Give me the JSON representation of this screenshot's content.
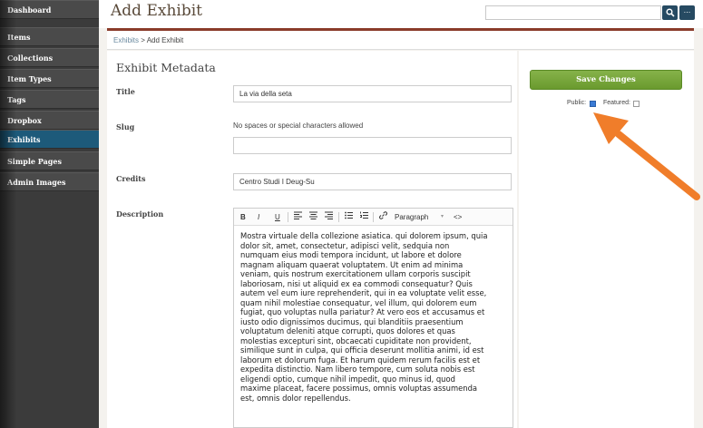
{
  "sidebar": {
    "items": [
      {
        "label": "Dashboard"
      },
      {
        "label": "Items"
      },
      {
        "label": "Collections"
      },
      {
        "label": "Item Types"
      },
      {
        "label": "Tags"
      },
      {
        "label": "Dropbox"
      },
      {
        "label": "Exhibits",
        "active": true
      },
      {
        "label": "Simple Pages"
      },
      {
        "label": "Admin Images"
      }
    ]
  },
  "header": {
    "title": "Add Exhibit",
    "search_value": "",
    "search_icon": "search-icon",
    "more_label": "..."
  },
  "breadcrumb": {
    "parent": "Exhibits",
    "separator": " > ",
    "current": "Add Exhibit"
  },
  "form": {
    "section_heading": "Exhibit Metadata",
    "title": {
      "label": "Title",
      "value": "La via della seta"
    },
    "slug": {
      "label": "Slug",
      "hint": "No spaces or special characters allowed",
      "value": ""
    },
    "credits": {
      "label": "Credits",
      "value": "Centro Studi I Deug-Su"
    },
    "description": {
      "label": "Description",
      "toolbar": {
        "bold": "B",
        "italic": "I",
        "underline": "U",
        "format": "Paragraph",
        "format_arrow": "▾",
        "code": "<>"
      },
      "text": "Mostra virtuale della collezione asiatica. qui dolorem ipsum, quia\ndolor sit, amet, consectetur, adipisci velit, sedquia non\nnumquam eius modi tempora incidunt, ut labore et dolore\nmagnam aliquam quaerat voluptatem. Ut enim ad minima\nveniam, quis nostrum exercitationem ullam corporis suscipit\nlaboriosam, nisi ut aliquid ex ea commodi consequatur? Quis\nautem vel eum iure reprehenderit, qui in ea voluptate velit esse,\nquam nihil molestiae consequatur, vel illum, qui dolorem eum\nfugiat, quo voluptas nulla pariatur? At vero eos et accusamus et\niusto odio dignissimos ducimus, qui blanditiis praesentium\nvoluptatum deleniti atque corrupti, quos dolores et quas\nmolestias excepturi sint, obcaecati cupiditate non provident,\nsimilique sunt in culpa, qui officia deserunt mollitia animi, id est\nlaborum et dolorum fuga. Et harum quidem rerum facilis est et\nexpedita distinctio. Nam libero tempore, cum soluta nobis est\neligendi optio, cumque nihil impedit, quo minus id, quod\nmaxime placeat, facere possimus, omnis voluptas assumenda\nest, omnis dolor repellendus."
    }
  },
  "side": {
    "save_label": "Save Changes",
    "public_label": "Public:",
    "public_checked": true,
    "featured_label": "Featured:",
    "featured_checked": false
  },
  "colors": {
    "sidebar_active": "#1d5a7a",
    "save_button": "#76a83a",
    "header_rule": "#8a3b2a",
    "annotation_arrow": "#f07d2a"
  }
}
